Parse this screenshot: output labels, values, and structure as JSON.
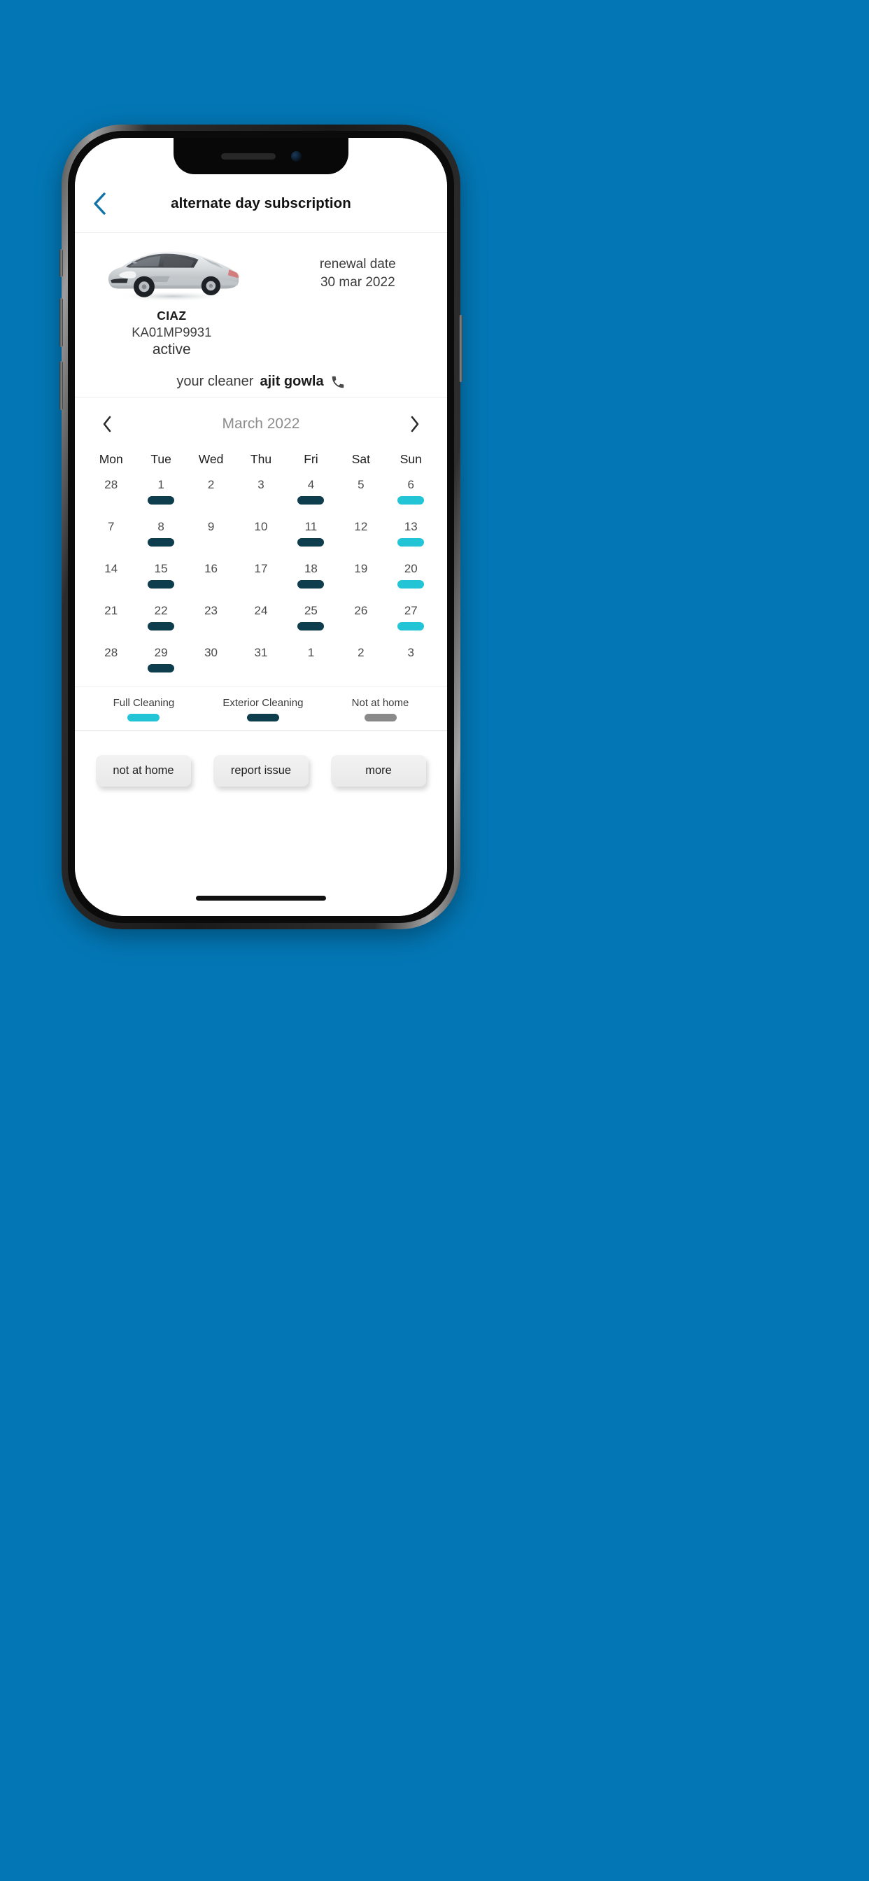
{
  "background_color": "#0377B5",
  "appbar": {
    "back_icon": "chevron-left-icon",
    "back_color": "#1273A8",
    "title": "alternate day subscription"
  },
  "vehicle": {
    "image_alt": "silver-sedan-car",
    "name": "CIAZ",
    "plate": "KA01MP9931",
    "status": "active",
    "renewal_label": "renewal date",
    "renewal_date": "30 mar 2022"
  },
  "cleaner": {
    "label": "your cleaner",
    "name": "ajit gowla",
    "call_icon": "phone-icon"
  },
  "calendar": {
    "prev_icon": "chevron-left-icon",
    "next_icon": "chevron-right-icon",
    "month": "March 2022",
    "weekdays": [
      "Mon",
      "Tue",
      "Wed",
      "Thu",
      "Fri",
      "Sat",
      "Sun"
    ],
    "colors": {
      "full_cleaning": "#22C4D6",
      "exterior_cleaning": "#0E3D4E",
      "not_at_home": "#8A8A8A"
    },
    "weeks": [
      [
        {
          "day": "28",
          "type": "none"
        },
        {
          "day": "1",
          "type": "exterior"
        },
        {
          "day": "2",
          "type": "none"
        },
        {
          "day": "3",
          "type": "none"
        },
        {
          "day": "4",
          "type": "exterior"
        },
        {
          "day": "5",
          "type": "none"
        },
        {
          "day": "6",
          "type": "full"
        }
      ],
      [
        {
          "day": "7",
          "type": "none"
        },
        {
          "day": "8",
          "type": "exterior"
        },
        {
          "day": "9",
          "type": "none"
        },
        {
          "day": "10",
          "type": "none"
        },
        {
          "day": "11",
          "type": "exterior"
        },
        {
          "day": "12",
          "type": "none"
        },
        {
          "day": "13",
          "type": "full"
        }
      ],
      [
        {
          "day": "14",
          "type": "none"
        },
        {
          "day": "15",
          "type": "exterior"
        },
        {
          "day": "16",
          "type": "none"
        },
        {
          "day": "17",
          "type": "none"
        },
        {
          "day": "18",
          "type": "exterior"
        },
        {
          "day": "19",
          "type": "none"
        },
        {
          "day": "20",
          "type": "full"
        }
      ],
      [
        {
          "day": "21",
          "type": "none"
        },
        {
          "day": "22",
          "type": "exterior"
        },
        {
          "day": "23",
          "type": "none"
        },
        {
          "day": "24",
          "type": "none"
        },
        {
          "day": "25",
          "type": "exterior"
        },
        {
          "day": "26",
          "type": "none"
        },
        {
          "day": "27",
          "type": "full"
        }
      ],
      [
        {
          "day": "28",
          "type": "none"
        },
        {
          "day": "29",
          "type": "exterior"
        },
        {
          "day": "30",
          "type": "none"
        },
        {
          "day": "31",
          "type": "none"
        },
        {
          "day": "1",
          "type": "none"
        },
        {
          "day": "2",
          "type": "none"
        },
        {
          "day": "3",
          "type": "none"
        }
      ]
    ]
  },
  "legend": [
    {
      "label": "Full Cleaning",
      "color": "#22C4D6"
    },
    {
      "label": "Exterior Cleaning",
      "color": "#0E3D4E"
    },
    {
      "label": "Not at home",
      "color": "#8A8A8A"
    }
  ],
  "actions": [
    {
      "label": "not at home"
    },
    {
      "label": "report issue"
    },
    {
      "label": "more"
    }
  ]
}
